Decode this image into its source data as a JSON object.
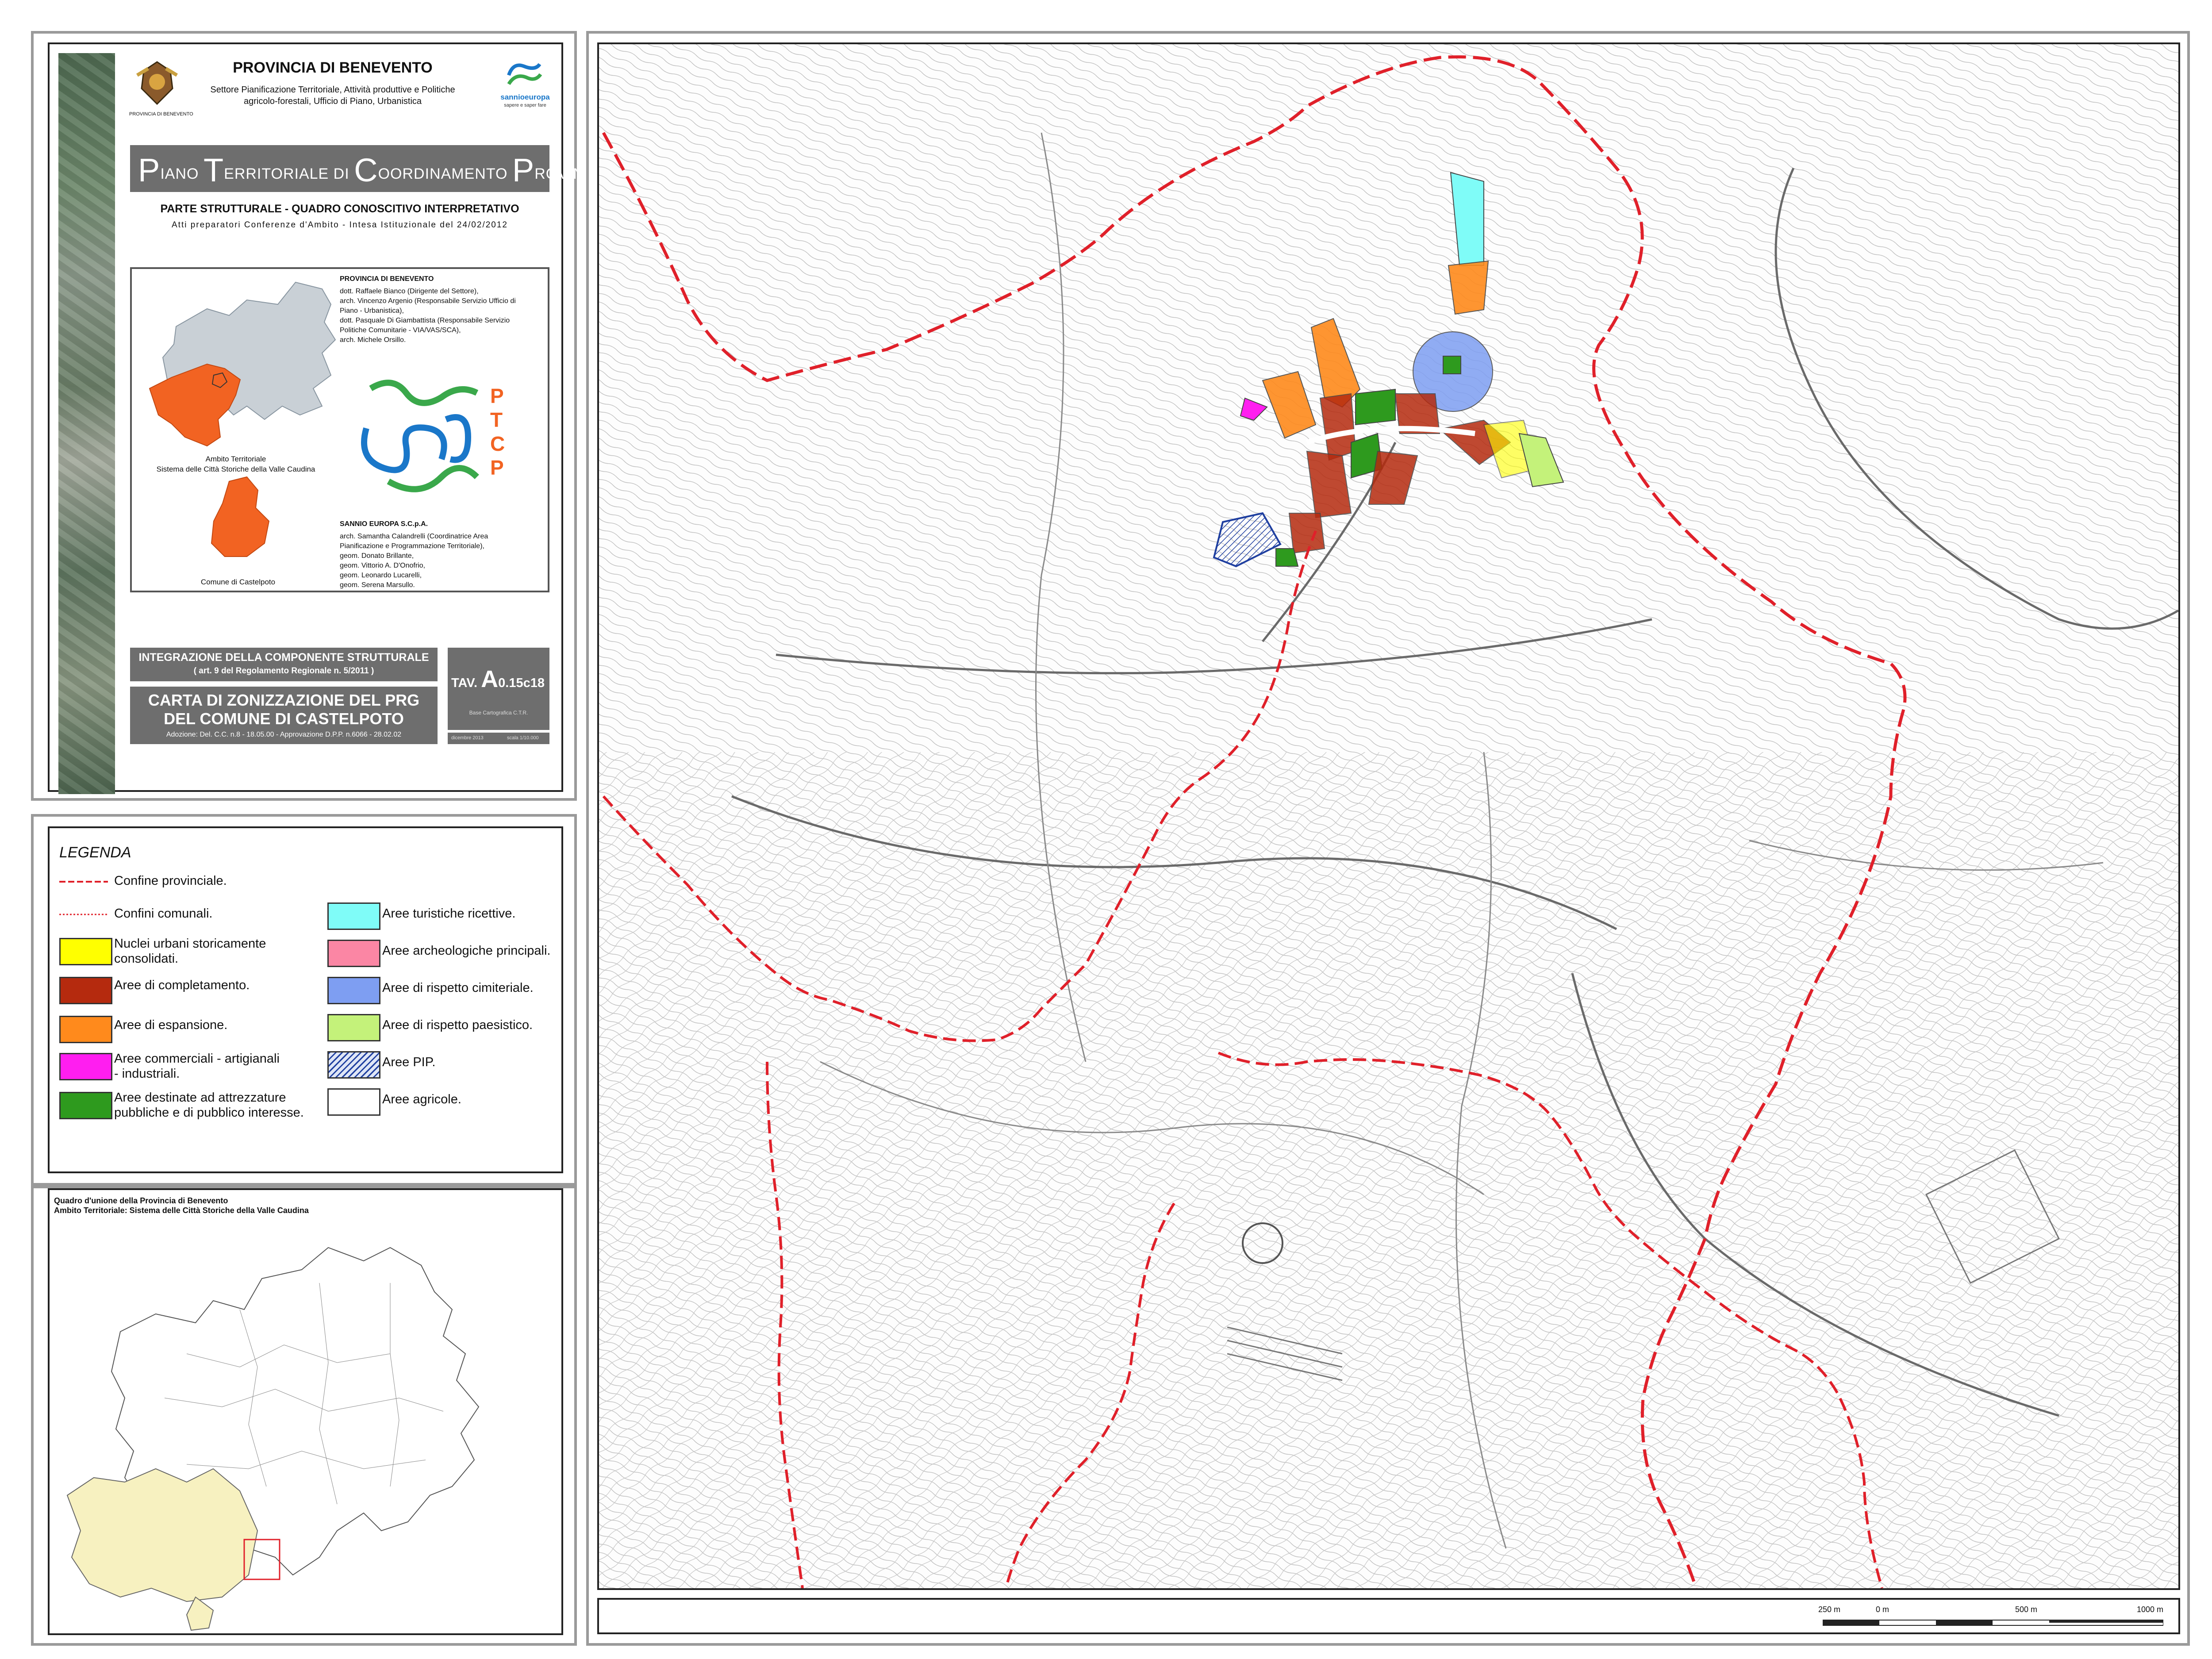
{
  "title_block": {
    "org_title": "PROVINCIA DI BENEVENTO",
    "logo_caption": "PROVINCIA DI BENEVENTO",
    "sector_line1": "Settore Pianificazione Territoriale, Attività produttive e Politiche",
    "sector_line2": "agricolo-forestali, Ufficio di Piano, Urbanistica",
    "partner_brand": "sannioeuropa",
    "partner_tagline1": "sapere e saper fare",
    "partner_tagline2": "",
    "plan_title_caps": [
      "P",
      "T",
      "C",
      "P"
    ],
    "plan_title_rest": [
      "IANO ",
      "ERRITORIALE DI ",
      "OORDINAMENTO ",
      "ROVINCIALE"
    ],
    "part_title": "PARTE STRUTTURALE - QUADRO CONOSCITIVO INTERPRETATIVO",
    "acts_line": "Atti preparatori Conferenze d'Ambito - Intesa Istituzionale del 24/02/2012",
    "ambito_label_line1": "Ambito Territoriale",
    "ambito_label_line2": "Sistema delle Città Storiche della Valle Caudina",
    "comune_label": "Comune di Castelpoto",
    "credits_header1": "PROVINCIA DI BENEVENTO",
    "credits1": [
      "dott. Raffaele Bianco (Dirigente del Settore),",
      "arch. Vincenzo Argenio (Responsabile Servizio Ufficio di",
      "Piano - Urbanistica),",
      "dott. Pasquale Di Giambattista (Responsabile Servizio",
      "Politiche Comunitarie - VIA/VAS/SCA),",
      "arch. Michele Orsillo."
    ],
    "ptcp_letters": [
      "P",
      "T",
      "C",
      "P"
    ],
    "credits_header2": "SANNIO EUROPA S.C.p.A.",
    "credits2": [
      "arch. Samantha Calandrelli (Coordinatrice Area",
      "Pianificazione e Programmazione Territoriale),",
      "geom. Donato Brillante,",
      "geom. Vittorio A. D'Onofrio,",
      "geom. Leonardo Lucarelli,",
      "geom. Serena Marsullo."
    ],
    "integration_line1": "INTEGRAZIONE DELLA COMPONENTE STRUTTURALE",
    "integration_line2": "( art. 9 del Regolamento Regionale n. 5/2011 )",
    "map_title_line1": "CARTA DI ZONIZZAZIONE DEL PRG",
    "map_title_line2": "DEL COMUNE DI CASTELPOTO",
    "adoption_line": "Adozione: Del. C.C. n.8 - 18.05.00 - Approvazione D.P.P. n.6066 - 28.02.02",
    "tav_prefix": "TAV.",
    "tav_big": "A",
    "tav_code": "0.15c18",
    "tav_base": "Base Cartografica C.T.R.",
    "tav_date": "dicembre 2013",
    "tav_scale": "scala 1/10.000"
  },
  "legend": {
    "title": "LEGENDA",
    "line_items": [
      {
        "label": "Confine provinciale.",
        "color": "#e0202a",
        "style": "dashed"
      },
      {
        "label": "Confini comunali.",
        "color": "#e0202a",
        "style": "dotted"
      }
    ],
    "left_items": [
      {
        "label": "Nuclei urbani storicamente\nconsolidati.",
        "color": "#ffff00"
      },
      {
        "label": "Aree di completamento.",
        "color": "#b52a0e"
      },
      {
        "label": "Aree di espansione.",
        "color": "#ff8a1c"
      },
      {
        "label": "Aree commerciali - artigianali\n- industriali.",
        "color": "#ff1ef0"
      },
      {
        "label": "Aree destinate ad attrezzature\npubbliche e di pubblico interesse.",
        "color": "#2e9a1e"
      }
    ],
    "right_items": [
      {
        "label": "Aree turistiche ricettive.",
        "color": "#7ffcf8"
      },
      {
        "label": "Aree archeologiche principali.",
        "color": "#fb86a4"
      },
      {
        "label": "Aree di rispetto cimiteriale.",
        "color": "#7e9ef2"
      },
      {
        "label": "Aree di rispetto paesistico.",
        "color": "#c4f27a"
      },
      {
        "label": "Aree PIP.",
        "color": "#c8d4ee",
        "pattern": "hatch"
      },
      {
        "label": "Aree agricole.",
        "color": "#ffffff"
      }
    ]
  },
  "overview": {
    "title_line1": "Quadro d'unione della Provincia di Benevento",
    "title_line2": "Ambito Territoriale: Sistema delle Città Storiche della Valle Caudina"
  },
  "scale_bar": {
    "labels": [
      "250 m",
      "0 m",
      "500 m",
      "1000 m"
    ]
  },
  "colors": {
    "boundary": "#e0202a",
    "panel_gray": "#6e6e6e",
    "ambito_fill": "#f26322",
    "province_fill": "#c9d0d6",
    "overview_fill": "#f7f1c0"
  }
}
